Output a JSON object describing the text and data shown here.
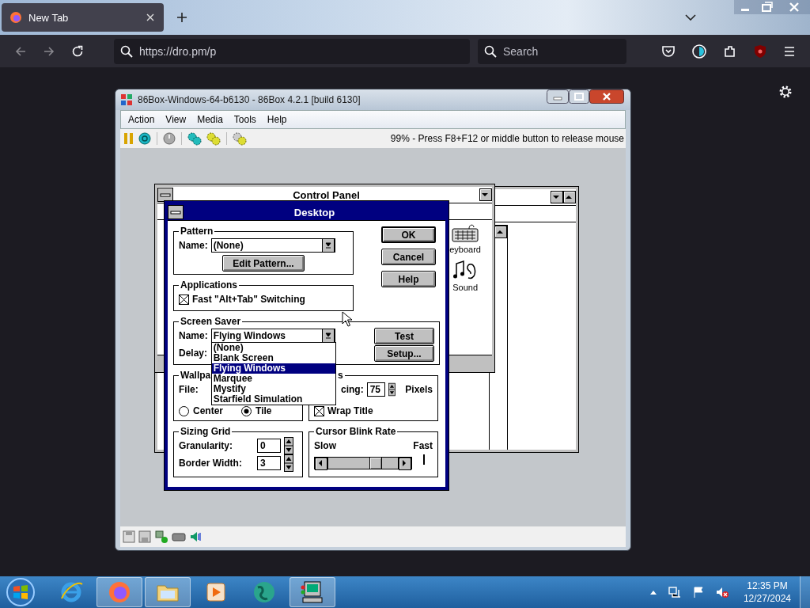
{
  "browser": {
    "tabs": [
      {
        "label": "New Tab",
        "selected": true
      }
    ],
    "url": "https://dro.pm/p",
    "search": {
      "placeholder": "Search"
    }
  },
  "emulator": {
    "title": "86Box-Windows-64-b6130 - 86Box 4.2.1 [build 6130]",
    "menu": [
      "Action",
      "View",
      "Media",
      "Tools",
      "Help"
    ],
    "status_text": "99% - Press F8+F12 or middle button to release mouse"
  },
  "control_panel": {
    "title": "Control Panel",
    "icons": [
      {
        "label": "eyboard",
        "kind": "keyboard"
      },
      {
        "label": "Sound",
        "kind": "sound"
      }
    ]
  },
  "dialog": {
    "title": "Desktop",
    "pattern": {
      "label": "Pattern",
      "name_label": "Name:",
      "value": "(None)",
      "edit_button": "Edit Pattern..."
    },
    "buttons": [
      {
        "label": "OK",
        "default": true
      },
      {
        "label": "Cancel",
        "default": false
      },
      {
        "label": "Help",
        "default": false
      }
    ],
    "applications": {
      "label": "Applications",
      "option": {
        "label": "Fast \"Alt+Tab\" Switching",
        "checked": true
      }
    },
    "screen_saver": {
      "label": "Screen Saver",
      "name_label": "Name:",
      "value": "Flying Windows",
      "delay_label": "Delay:",
      "options": [
        {
          "label": "(None)",
          "selected": false
        },
        {
          "label": "Blank Screen",
          "selected": false
        },
        {
          "label": "Flying Windows",
          "selected": true
        },
        {
          "label": "Marquee",
          "selected": false
        },
        {
          "label": "Mystify",
          "selected": false
        },
        {
          "label": "Starfield Simulation",
          "selected": false
        }
      ],
      "buttons": [
        "Test",
        "Setup..."
      ]
    },
    "wallpaper": {
      "label": "Wallpa",
      "file_label": "File:",
      "layout": [
        {
          "label": "Center",
          "selected": false
        },
        {
          "label": "Tile",
          "selected": true
        }
      ]
    },
    "icons": {
      "label": "s",
      "spacing_label": "cing:",
      "spacing": "75",
      "unit": "Pixels",
      "wrap_title": {
        "label": "Wrap Title",
        "checked": true
      }
    },
    "sizing_grid": {
      "label": "Sizing Grid",
      "fields": [
        {
          "label": "Granularity:",
          "value": "0"
        },
        {
          "label": "Border Width:",
          "value": "3"
        }
      ]
    },
    "cursor_blink_rate": {
      "label": "Cursor Blink Rate",
      "slow": "Slow",
      "fast": "Fast"
    }
  },
  "taskbar": {
    "apps": [
      {
        "kind": "ie",
        "running": false
      },
      {
        "kind": "firefox",
        "running": true
      },
      {
        "kind": "folder",
        "running": true
      },
      {
        "kind": "media",
        "running": false
      },
      {
        "kind": "globe",
        "running": false
      },
      {
        "kind": "computer",
        "running": true
      }
    ],
    "time": "12:35 PM",
    "date": "12/27/2024"
  }
}
